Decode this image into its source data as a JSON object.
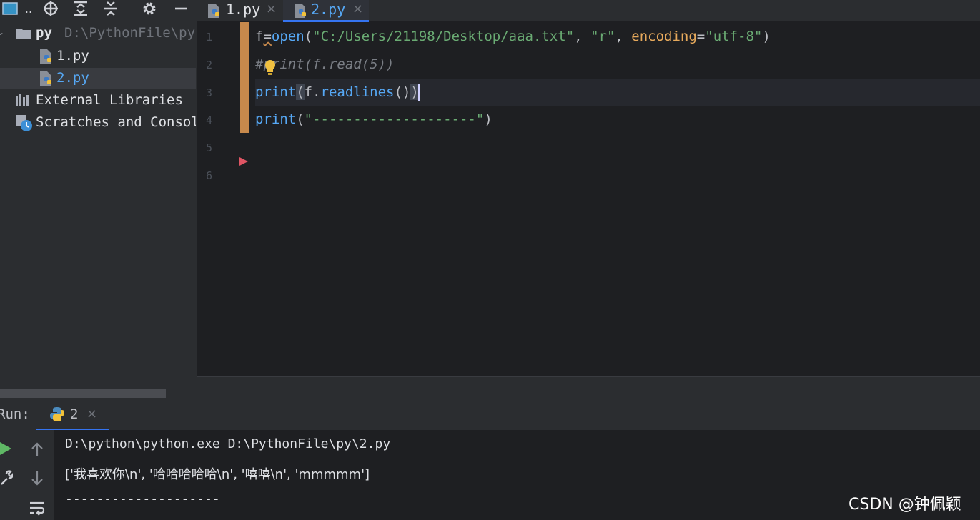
{
  "project": {
    "toolbar_dots": "..",
    "tree": [
      {
        "label": "py",
        "path": "D:\\PythonFile\\py"
      },
      {
        "label": "1.py"
      },
      {
        "label": "2.py"
      },
      {
        "label": "External Libraries"
      },
      {
        "label": "Scratches and Consoles"
      }
    ]
  },
  "tabs": [
    {
      "label": "1.py",
      "active": false
    },
    {
      "label": "2.py",
      "active": true
    }
  ],
  "editor": {
    "line_numbers": [
      "1",
      "2",
      "3",
      "4",
      "5",
      "6"
    ],
    "lines": {
      "l1": {
        "var": "f",
        "eq": "=",
        "func": "open",
        "p_open": "(",
        "path": "\"C:/Users/21198/Desktop/aaa.txt\"",
        "comma1": ", ",
        "mode": "\"r\"",
        "comma2": ", ",
        "kw": "encoding",
        "eq2": "=",
        "enc": "\"utf-8\"",
        "p_close": ")"
      },
      "l2": {
        "comment": "#print(f.read(5))"
      },
      "l3": {
        "func": "print",
        "p_open": "(",
        "obj": "f.",
        "method": "readlines",
        "call": "()",
        "p_close": ")"
      },
      "l4": {
        "func": "print",
        "p_open": "(",
        "str": "\"--------------------\"",
        "p_close": ")"
      }
    }
  },
  "run": {
    "label": "Run:",
    "tab_label": "2",
    "console": [
      "D:\\python\\python.exe D:\\PythonFile\\py\\2.py",
      "['我喜欢你\\n', '哈哈哈哈哈\\n', '嘻嘻\\n', 'mmmmm']",
      "--------------------"
    ]
  },
  "watermark": "CSDN @钟佩颖",
  "colors": {
    "accent": "#3574f0",
    "keyword": "#56a8f5",
    "string": "#6aab73",
    "kwarg": "#e6a95c",
    "comment": "#7a7e85",
    "run_green": "#5fb865"
  }
}
